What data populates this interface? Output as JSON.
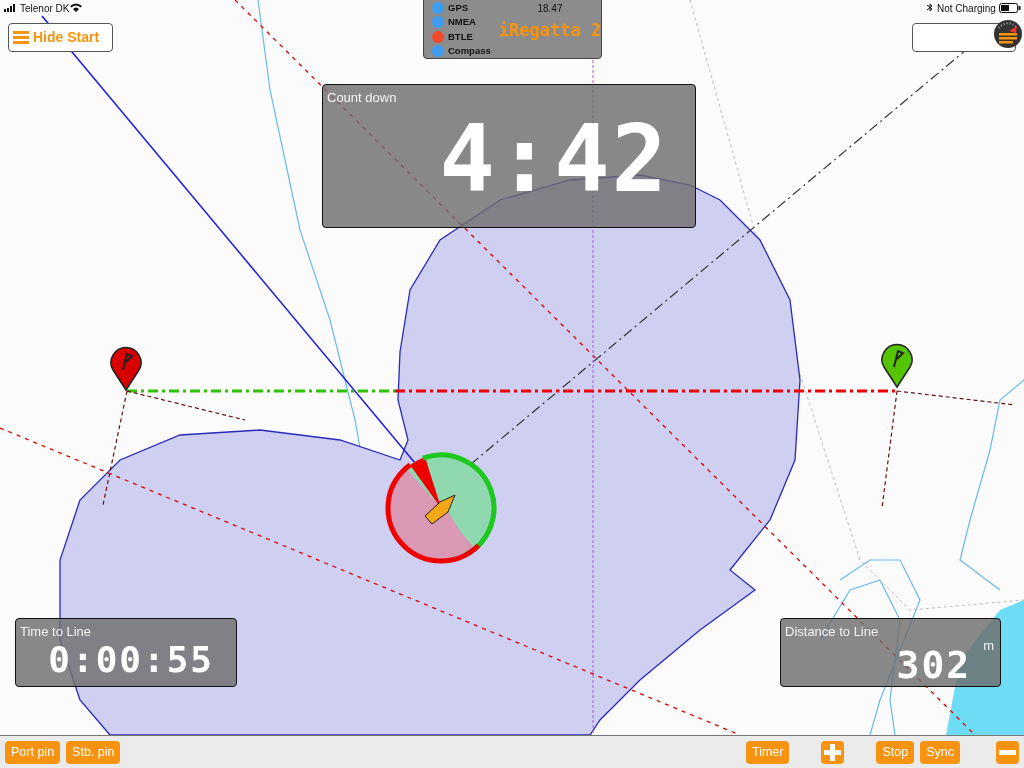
{
  "status_bar": {
    "carrier": "Telenor DK",
    "battery_text": "Not Charging"
  },
  "menu_button": {
    "label": "Hide Start"
  },
  "sensor_panel": {
    "sensors": [
      {
        "label": "GPS",
        "color": "#3d9df2"
      },
      {
        "label": "NMEA",
        "color": "#3d9df2"
      },
      {
        "label": "BTLE",
        "color": "#f04a2a"
      },
      {
        "label": "Compass",
        "color": "#3d9df2"
      }
    ],
    "time": "18.47",
    "app_title": "iRegatta 2"
  },
  "countdown": {
    "label": "Count down",
    "value": "4:42"
  },
  "pins": [
    {
      "color": "#d80000"
    },
    {
      "color": "#55c400"
    }
  ],
  "time_to_line": {
    "label": "Time to Line",
    "value": "0:00:55"
  },
  "distance_to_line": {
    "label": "Distance to Line",
    "value": "302",
    "unit": "m"
  },
  "toolbar": [
    {
      "kind": "text",
      "label": "Port pin"
    },
    {
      "kind": "text",
      "label": "Stb. pin"
    },
    {
      "kind": "spacer"
    },
    {
      "kind": "text",
      "label": "Timer"
    },
    {
      "kind": "plus"
    },
    {
      "kind": "text",
      "label": "Stop"
    },
    {
      "kind": "text",
      "label": "Sync"
    },
    {
      "kind": "minus"
    }
  ]
}
